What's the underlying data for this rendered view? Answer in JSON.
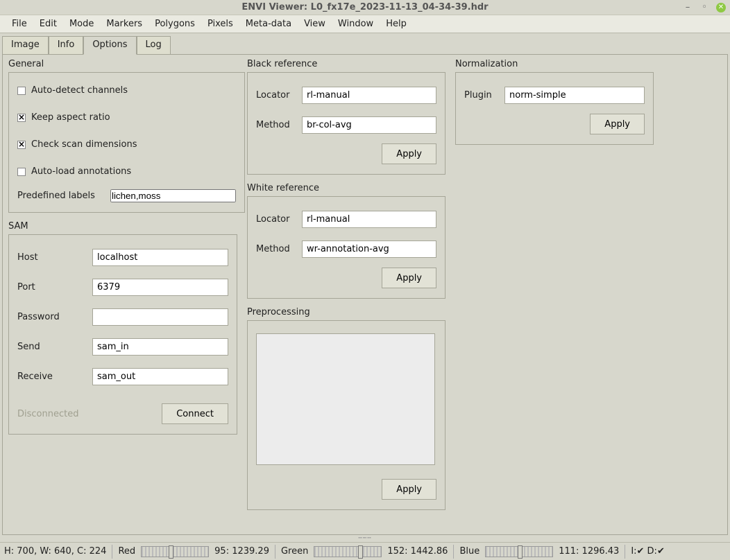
{
  "window": {
    "title": "ENVI Viewer: L0_fx17e_2023-11-13_04-34-39.hdr"
  },
  "menu": [
    "File",
    "Edit",
    "Mode",
    "Markers",
    "Polygons",
    "Pixels",
    "Meta-data",
    "View",
    "Window",
    "Help"
  ],
  "tabs": [
    "Image",
    "Info",
    "Options",
    "Log"
  ],
  "active_tab": "Options",
  "general": {
    "title": "General",
    "auto_detect": {
      "label": "Auto-detect channels",
      "checked": false
    },
    "keep_aspect": {
      "label": "Keep aspect ratio",
      "checked": true
    },
    "check_scan": {
      "label": "Check scan dimensions",
      "checked": true
    },
    "auto_load": {
      "label": "Auto-load annotations",
      "checked": false
    },
    "predefined_label": "Predefined labels",
    "predefined_value": "lichen,moss"
  },
  "sam": {
    "title": "SAM",
    "host_label": "Host",
    "host": "localhost",
    "port_label": "Port",
    "port": "6379",
    "password_label": "Password",
    "password": "",
    "send_label": "Send",
    "send": "sam_in",
    "receive_label": "Receive",
    "receive": "sam_out",
    "status": "Disconnected",
    "connect": "Connect"
  },
  "black_ref": {
    "title": "Black reference",
    "locator_label": "Locator",
    "locator": "rl-manual",
    "method_label": "Method",
    "method": "br-col-avg",
    "apply": "Apply"
  },
  "white_ref": {
    "title": "White reference",
    "locator_label": "Locator",
    "locator": "rl-manual",
    "method_label": "Method",
    "method": "wr-annotation-avg",
    "apply": "Apply"
  },
  "preproc": {
    "title": "Preprocessing",
    "apply": "Apply"
  },
  "norm": {
    "title": "Normalization",
    "plugin_label": "Plugin",
    "plugin": "norm-simple",
    "apply": "Apply"
  },
  "status": {
    "dims": "H: 700, W: 640, C: 224",
    "red": "Red",
    "red_val": "95: 1239.29",
    "green": "Green",
    "green_val": "152: 1442.86",
    "blue": "Blue",
    "blue_val": "111: 1296.43",
    "io": "I:✔ D:✔"
  }
}
